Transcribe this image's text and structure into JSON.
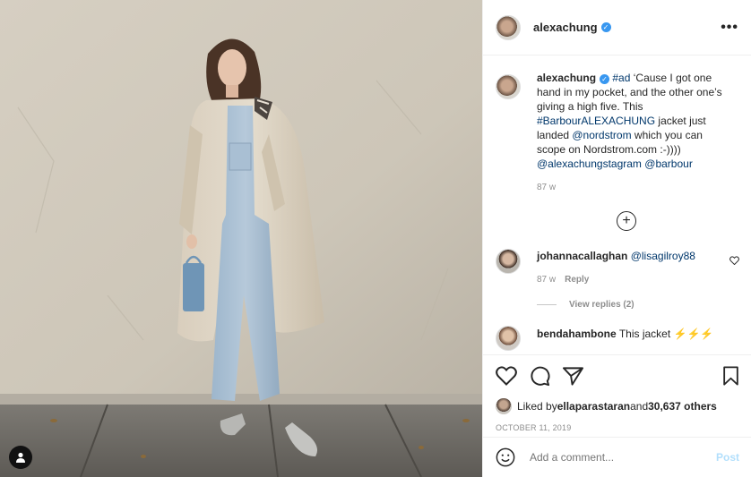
{
  "post": {
    "username": "alexachung",
    "verified": true,
    "more_label": "•••"
  },
  "caption": {
    "username": "alexachung",
    "hashtag_ad": "#ad",
    "text1": " ‘Cause I got one hand in my pocket, and the other one’s giving a high five. This ",
    "hashtag_barbour": "#BarbourALEXACHUNG",
    "text2": " jacket just landed ",
    "mention_nordstrom": "@nordstrom",
    "text3": " which you can scope on Nordstrom.com :-)))) ",
    "mention_stagram": "@alexachungstagram",
    "text4": " ",
    "mention_barbour": "@barbour",
    "time": "87 w"
  },
  "load_more_icon": "plus-circle-icon",
  "comment1": {
    "username": "johannacallaghan",
    "mention": "@lisagilroy88",
    "time": "87 w",
    "reply_label": "Reply",
    "view_replies": "View replies (2)"
  },
  "comment2": {
    "username": "bendahambone",
    "text": "This jacket ⚡⚡⚡"
  },
  "actions": {
    "like_icon": "heart-icon",
    "comment_icon": "comment-icon",
    "share_icon": "paper-plane-icon",
    "save_icon": "bookmark-icon"
  },
  "likes": {
    "prefix": "Liked by ",
    "user": "ellaparastaran",
    "middle": " and ",
    "count": "30,637 others"
  },
  "date": "OCTOBER 11, 2019",
  "add_comment": {
    "placeholder": "Add a comment...",
    "post_label": "Post",
    "emoji_icon": "smiley-icon"
  },
  "colors": {
    "verified": "#3897f0",
    "link": "#00376b",
    "muted": "#8e8e8e",
    "post_disabled": "#b2dffc"
  }
}
